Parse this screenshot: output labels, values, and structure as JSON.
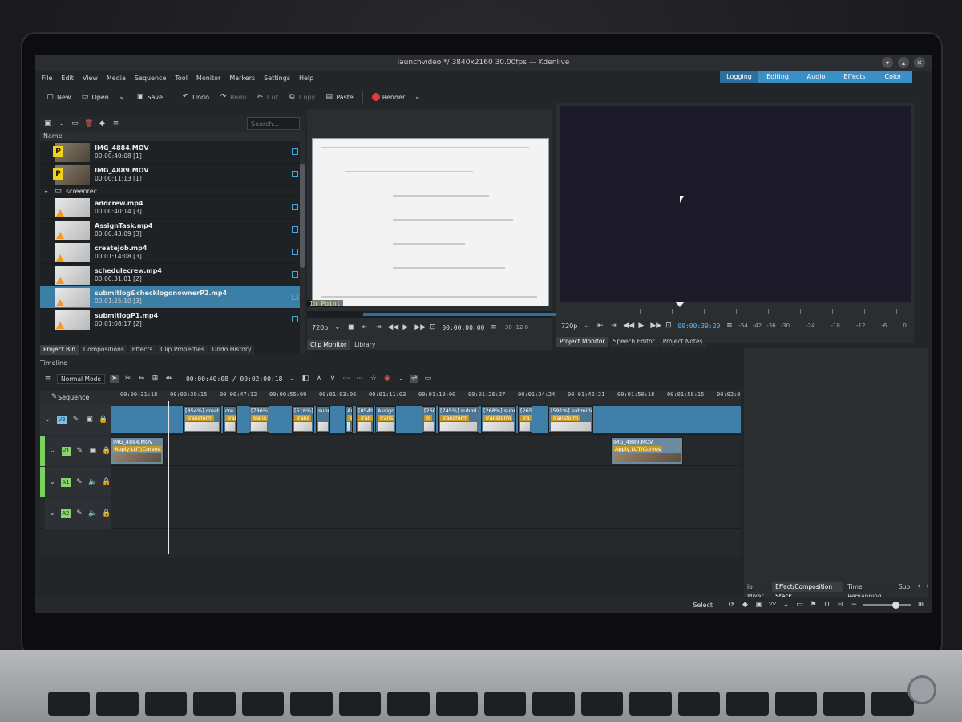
{
  "window": {
    "title": "launchvideo */ 3840x2160 30.00fps — Kdenlive"
  },
  "menus": [
    "File",
    "Edit",
    "View",
    "Media",
    "Sequence",
    "Tool",
    "Monitor",
    "Markers",
    "Settings",
    "Help"
  ],
  "layouts": [
    "Logging",
    "Editing",
    "Audio",
    "Effects",
    "Color"
  ],
  "toolbar": {
    "new": "New",
    "open": "Open...",
    "save": "Save",
    "undo": "Undo",
    "redo": "Redo",
    "cut": "Cut",
    "copy": "Copy",
    "paste": "Paste",
    "render": "Render..."
  },
  "bin": {
    "search_placeholder": "Search...",
    "header": "Name",
    "folder": "screenrec",
    "items": [
      {
        "name": "IMG_4884.MOV",
        "duration": "00:00:40:08 [1]",
        "type": "video",
        "badge": "P"
      },
      {
        "name": "IMG_4889.MOV",
        "duration": "00:00:11:13 [1]",
        "type": "video",
        "badge": "P"
      },
      {
        "name": "addcrew.mp4",
        "duration": "00:00:40:14 [3]",
        "type": "screen"
      },
      {
        "name": "AssignTask.mp4",
        "duration": "00:00:43:09 [3]",
        "type": "screen"
      },
      {
        "name": "createjob.mp4",
        "duration": "00:01:14:08 [3]",
        "type": "screen"
      },
      {
        "name": "schedulecrew.mp4",
        "duration": "00:00:31:01 [2]",
        "type": "screen"
      },
      {
        "name": "submitlog&checklogonownerP2.mp4",
        "duration": "00:01:25:10 [3]",
        "type": "screen",
        "selected": true
      },
      {
        "name": "submitlogP1.mp4",
        "duration": "00:01:08:17 [2]",
        "type": "screen"
      }
    ],
    "tabs": [
      "Project Bin",
      "Compositions",
      "Effects",
      "Clip Properties",
      "Undo History"
    ]
  },
  "clip_monitor": {
    "in_point": "In Point",
    "resolution": "720p",
    "timecode": "00:00:00:00",
    "vu": "-30 -12 0",
    "tabs": [
      "Clip Monitor",
      "Library"
    ]
  },
  "project_monitor": {
    "resolution": "720p",
    "timecode": "00:00:39:20",
    "scale": [
      "-54",
      "-42",
      "-36",
      "-30",
      "-24",
      "-18",
      "-12",
      "-6",
      "0"
    ],
    "tabs": [
      "Project Monitor",
      "Speech Editor",
      "Project Notes"
    ]
  },
  "timeline": {
    "label": "Timeline",
    "mode": "Normal Mode",
    "position": "00:00:40:08 / 00:02:00:18",
    "sequence": "Sequence",
    "ruler": [
      "00:00:31:18",
      "00:00:39:15",
      "00:00:47:12",
      "00:00:55:09",
      "00:01:03:06",
      "00:01:11:03",
      "00:01:19:00",
      "00:01:26:27",
      "00:01:34:24",
      "00:01:42:21",
      "00:01:50:18",
      "00:01:58:15",
      "00:02:0"
    ],
    "tracks": [
      "V2",
      "V1",
      "A1",
      "A2"
    ],
    "v2_clips": [
      {
        "label": "[854%] create",
        "fx": "Transform"
      },
      {
        "label": "cre",
        "fx": "Trans"
      },
      {
        "label": "[786%]",
        "fx": "Trans"
      },
      {
        "label": "[518%]",
        "fx": "Trans"
      },
      {
        "label": "subm",
        "fx": ""
      },
      {
        "label": "As",
        "fx": "Tr"
      },
      {
        "label": "[854%]",
        "fx": "Tran"
      },
      {
        "label": "Assign",
        "fx": "Trans"
      },
      {
        "label": "[260",
        "fx": "Tr"
      },
      {
        "label": "[745%] submi",
        "fx": "Transform"
      },
      {
        "label": "[268%] subm",
        "fx": "Transform"
      },
      {
        "label": "[265",
        "fx": "Tra"
      },
      {
        "label": "[591%] submitlo",
        "fx": "Transform"
      }
    ],
    "v1_clips": [
      {
        "label": "IMG_4884.MOV",
        "fx": "Apply LUT/Curves"
      },
      {
        "label": "IMG_4889.MOV",
        "fx": "Apply LUT/Curves"
      }
    ]
  },
  "right_tabs": [
    "io Mixer",
    "Effect/Composition Stack",
    "Time Remapping",
    "Sub"
  ],
  "status": {
    "select": "Select"
  }
}
